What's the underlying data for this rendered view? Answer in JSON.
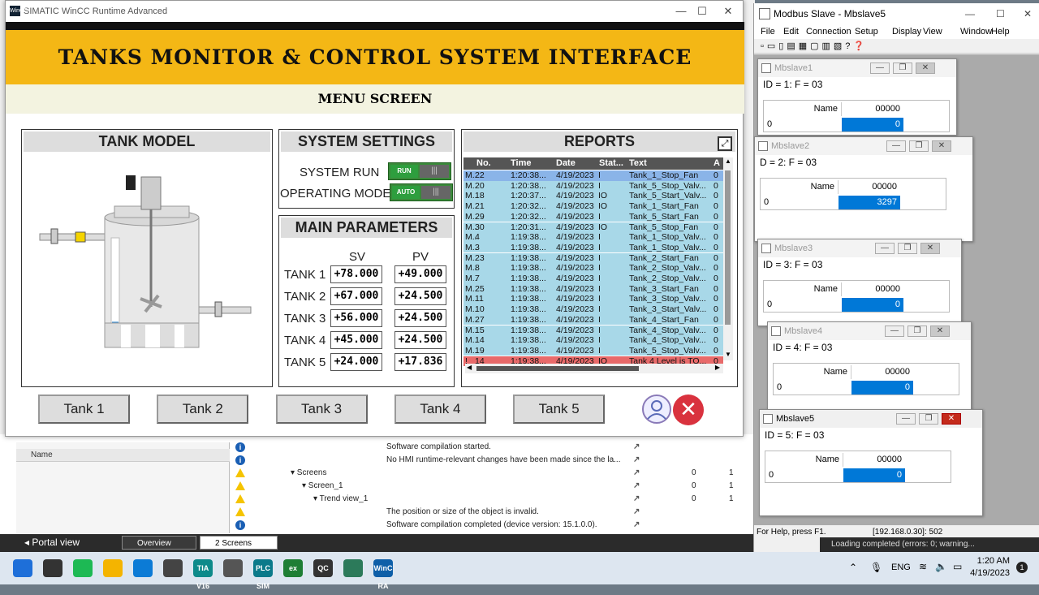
{
  "wincc": {
    "window_title": "SIMATIC WinCC Runtime Advanced",
    "logo_text": "WinCC",
    "banner": "TANKS MONITOR & CONTROL SYSTEM INTERFACE",
    "screen_name": "MENU SCREEN",
    "tank_model": {
      "title": "TANK MODEL",
      "level_fraction": 0.2
    },
    "system_settings": {
      "title": "SYSTEM SETTINGS",
      "rows": [
        {
          "label": "SYSTEM RUN",
          "state": "RUN"
        },
        {
          "label": "OPERATING MODE",
          "state": "AUTO"
        }
      ]
    },
    "main_parameters": {
      "title": "MAIN PARAMETERS",
      "sv_header": "SV",
      "pv_header": "PV",
      "rows": [
        {
          "tank": "TANK 1",
          "sv": "+78.000",
          "pv": "+49.000"
        },
        {
          "tank": "TANK 2",
          "sv": "+67.000",
          "pv": "+24.500"
        },
        {
          "tank": "TANK 3",
          "sv": "+56.000",
          "pv": "+24.500"
        },
        {
          "tank": "TANK 4",
          "sv": "+45.000",
          "pv": "+24.500"
        },
        {
          "tank": "TANK 5",
          "sv": "+24.000",
          "pv": "+17.836"
        }
      ]
    },
    "reports": {
      "title": "REPORTS",
      "columns": [
        "No.",
        "Time",
        "Date",
        "Stat...",
        "Text",
        "A"
      ],
      "rows": [
        {
          "m": "M..",
          "no": "22",
          "time": "1:20:38...",
          "date": "4/19/2023",
          "st": "I",
          "text": "Tank_1_Stop_Fan",
          "a": "0",
          "hl": "sel"
        },
        {
          "m": "M..",
          "no": "20",
          "time": "1:20:38...",
          "date": "4/19/2023",
          "st": "I",
          "text": "Tank_5_Stop_Valv...",
          "a": "0",
          "hl": ""
        },
        {
          "m": "M..",
          "no": "18",
          "time": "1:20:37...",
          "date": "4/19/2023",
          "st": "IO",
          "text": "Tank_5_Start_Valv...",
          "a": "0",
          "hl": ""
        },
        {
          "m": "M..",
          "no": "21",
          "time": "1:20:32...",
          "date": "4/19/2023",
          "st": "IO",
          "text": "Tank_1_Start_Fan",
          "a": "0",
          "hl": ""
        },
        {
          "m": "M..",
          "no": "29",
          "time": "1:20:32...",
          "date": "4/19/2023",
          "st": "I",
          "text": "Tank_5_Start_Fan",
          "a": "0",
          "hl": ""
        },
        {
          "m": "M..",
          "no": "30",
          "time": "1:20:31...",
          "date": "4/19/2023",
          "st": "IO",
          "text": "Tank_5_Stop_Fan",
          "a": "0",
          "hl": ""
        },
        {
          "m": "M..",
          "no": "4",
          "time": "1:19:38...",
          "date": "4/19/2023",
          "st": "I",
          "text": "Tank_1_Stop_Valv...",
          "a": "0",
          "hl": ""
        },
        {
          "m": "M..",
          "no": "3",
          "time": "1:19:38...",
          "date": "4/19/2023",
          "st": "I",
          "text": "Tank_1_Stop_Valv...",
          "a": "0",
          "hl": ""
        },
        {
          "m": "M..",
          "no": "23",
          "time": "1:19:38...",
          "date": "4/19/2023",
          "st": "I",
          "text": "Tank_2_Start_Fan",
          "a": "0",
          "hl": ""
        },
        {
          "m": "M..",
          "no": "8",
          "time": "1:19:38...",
          "date": "4/19/2023",
          "st": "I",
          "text": "Tank_2_Stop_Valv...",
          "a": "0",
          "hl": ""
        },
        {
          "m": "M..",
          "no": "7",
          "time": "1:19:38...",
          "date": "4/19/2023",
          "st": "I",
          "text": "Tank_2_Stop_Valv...",
          "a": "0",
          "hl": ""
        },
        {
          "m": "M..",
          "no": "25",
          "time": "1:19:38...",
          "date": "4/19/2023",
          "st": "I",
          "text": "Tank_3_Start_Fan",
          "a": "0",
          "hl": ""
        },
        {
          "m": "M..",
          "no": "11",
          "time": "1:19:38...",
          "date": "4/19/2023",
          "st": "I",
          "text": "Tank_3_Stop_Valv...",
          "a": "0",
          "hl": ""
        },
        {
          "m": "M..",
          "no": "10",
          "time": "1:19:38...",
          "date": "4/19/2023",
          "st": "I",
          "text": "Tank_3_Start_Valv...",
          "a": "0",
          "hl": ""
        },
        {
          "m": "M..",
          "no": "27",
          "time": "1:19:38...",
          "date": "4/19/2023",
          "st": "I",
          "text": "Tank_4_Start_Fan",
          "a": "0",
          "hl": ""
        },
        {
          "m": "M..",
          "no": "15",
          "time": "1:19:38...",
          "date": "4/19/2023",
          "st": "I",
          "text": "Tank_4_Stop_Valv...",
          "a": "0",
          "hl": ""
        },
        {
          "m": "M..",
          "no": "14",
          "time": "1:19:38...",
          "date": "4/19/2023",
          "st": "I",
          "text": "Tank_4_Stop_Valv...",
          "a": "0",
          "hl": ""
        },
        {
          "m": "M..",
          "no": "19",
          "time": "1:19:38...",
          "date": "4/19/2023",
          "st": "I",
          "text": "Tank_5_Stop_Valv...",
          "a": "0",
          "hl": ""
        },
        {
          "m": "!",
          "no": "14",
          "time": "1:19:38...",
          "date": "4/19/2023",
          "st": "IO",
          "text": "Tank 4 Level is TO...",
          "a": "0",
          "hl": "alarm"
        }
      ]
    },
    "tank_buttons": [
      "Tank 1",
      "Tank 2",
      "Tank 3",
      "Tank 4",
      "Tank 5"
    ]
  },
  "tia": {
    "left_header": "Name",
    "log_rows": [
      {
        "kind": "info",
        "indent": 190,
        "text": "Software compilation started.",
        "arrow": "↗",
        "n1": "",
        "n2": ""
      },
      {
        "kind": "info",
        "indent": 190,
        "text": "No HMI runtime-relevant changes have been made since the la...",
        "arrow": "↗",
        "n1": "",
        "n2": ""
      },
      {
        "kind": "warn",
        "indent": 72,
        "text": "▾ Screens",
        "arrow": "↗",
        "n1": "0",
        "n2": "1"
      },
      {
        "kind": "warn",
        "indent": 86,
        "text": "▾ Screen_1",
        "arrow": "↗",
        "n1": "0",
        "n2": "1"
      },
      {
        "kind": "warn",
        "indent": 100,
        "text": "▾ Trend view_1",
        "arrow": "↗",
        "n1": "0",
        "n2": "1"
      },
      {
        "kind": "warn",
        "indent": 190,
        "text": "The position or size of the object is invalid.",
        "arrow": "↗",
        "n1": "",
        "n2": ""
      },
      {
        "kind": "info",
        "indent": 190,
        "text": "Software compilation completed (device version: 15.1.0.0).",
        "arrow": "↗",
        "n1": "",
        "n2": ""
      }
    ],
    "portal_view": "Portal view",
    "tab_overview": "Overview",
    "tab_screens": "2 Screens",
    "status_message": "Loading completed (errors: 0; warning..."
  },
  "modbus": {
    "title": "Modbus Slave - Mbslave5",
    "menu": [
      "File",
      "Edit",
      "Connection",
      "Setup",
      "Display",
      "View",
      "Window",
      "Help"
    ],
    "status_left": "For Help, press F1.",
    "status_right": "[192.168.0.30]: 502",
    "slaves": [
      {
        "name": "Mbslave1",
        "info": "ID = 1: F = 03",
        "col_name": "Name",
        "col_head": "00000",
        "row": "0",
        "value": "0"
      },
      {
        "name": "Mbslave2",
        "info": "D = 2: F = 03",
        "col_name": "Name",
        "col_head": "00000",
        "row": "0",
        "value": "3297"
      },
      {
        "name": "Mbslave3",
        "info": "ID = 3: F = 03",
        "col_name": "Name",
        "col_head": "00000",
        "row": "0",
        "value": "0"
      },
      {
        "name": "Mbslave4",
        "info": "ID = 4: F = 03",
        "col_name": "Name",
        "col_head": "00000",
        "row": "0",
        "value": "0"
      },
      {
        "name": "Mbslave5",
        "info": "ID = 5: F = 03",
        "col_name": "Name",
        "col_head": "00000",
        "row": "0",
        "value": "0"
      }
    ]
  },
  "taskbar": {
    "apps": [
      {
        "icon": "windows-start-icon",
        "label": "",
        "color": "#1e6fd9"
      },
      {
        "icon": "search-icon",
        "label": "",
        "color": "#333333"
      },
      {
        "icon": "spotify-icon",
        "label": "",
        "color": "#1db954"
      },
      {
        "icon": "file-explorer-icon",
        "label": "",
        "color": "#f4b400"
      },
      {
        "icon": "edge-icon",
        "label": "",
        "color": "#0c7bd6"
      },
      {
        "icon": "clock-app-icon",
        "label": "",
        "color": "#444444"
      },
      {
        "icon": "tia-portal-icon",
        "label": "TIA V16",
        "color": "#0d8a8a"
      },
      {
        "icon": "tool-icon",
        "label": "",
        "color": "#555555"
      },
      {
        "icon": "plcsim-icon",
        "label": "PLC SIM",
        "color": "#0b7a8a"
      },
      {
        "icon": "excel-icon",
        "label": "ex",
        "color": "#1e7e34"
      },
      {
        "icon": "qc-icon",
        "label": "QC",
        "color": "#333333"
      },
      {
        "icon": "modbus-app-icon",
        "label": "",
        "color": "#2c7a5a"
      },
      {
        "icon": "wincc-ra-icon",
        "label": "WinC RA",
        "color": "#0e5fa8"
      }
    ],
    "lang": "ENG",
    "time": "1:20 AM",
    "date": "4/19/2023"
  }
}
